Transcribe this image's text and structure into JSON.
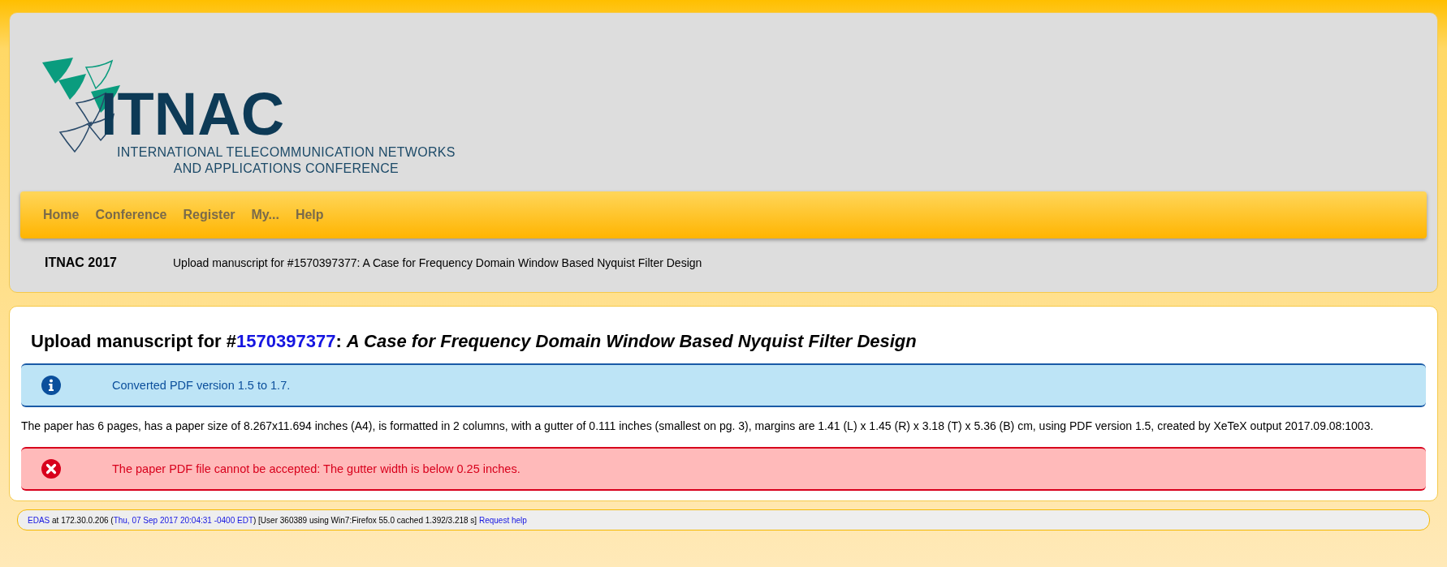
{
  "logo": {
    "name": "ITNAC",
    "subtitle_lines": [
      "INTERNATIONAL TELECOMMUNICATION NETWORKS",
      "AND APPLICATIONS CONFERENCE"
    ]
  },
  "nav": [
    "Home",
    "Conference",
    "Register",
    "My...",
    "Help"
  ],
  "breadcrumb": {
    "conference": "ITNAC 2017",
    "page": "Upload manuscript for #1570397377: A Case for Frequency Domain Window Based Nyquist Filter Design"
  },
  "heading": {
    "prefix": "Upload manuscript for #",
    "paper_id": "1570397377",
    "separator": ": ",
    "paper_title": "A Case for Frequency Domain Window Based Nyquist Filter Design"
  },
  "messages": [
    {
      "kind": "info",
      "text": "Converted PDF version 1.5 to 1.7."
    },
    {
      "kind": "paragraph",
      "text": "The paper has 6 pages, has a paper size of 8.267x11.694 inches (A4), is formatted in 2 columns, with a gutter of 0.111 inches (smallest on pg. 3), margins are 1.41 (L) x 1.45 (R) x 3.18 (T) x 5.36 (B) cm, using PDF version 1.5, created by XeTeX output 2017.09.08:1003."
    },
    {
      "kind": "error",
      "text": "The paper PDF file cannot be accepted: The gutter width is below 0.25 inches."
    }
  ],
  "footer": {
    "system": "EDAS",
    "host": " at 172.30.0.206 (",
    "time": "Thu, 07 Sep 2017 20:04:31 -0400 EDT",
    "details": ") [User 360389 using Win7:Firefox 55.0 cached 1.392/3.218 s] ",
    "help": "Request help"
  }
}
